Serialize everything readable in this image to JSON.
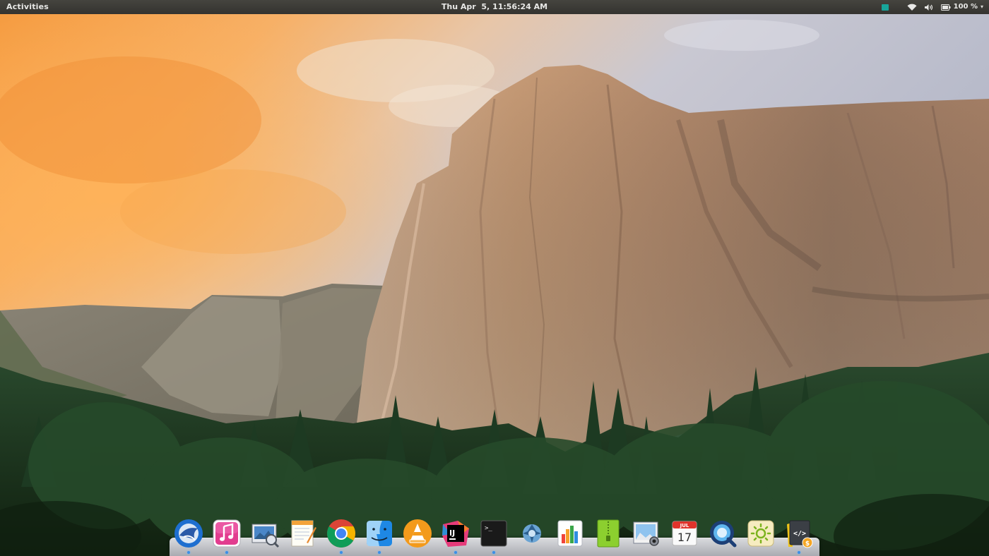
{
  "topbar": {
    "activities_label": "Activities",
    "clock": "Thu Apr  5, 11:56:24 AM",
    "battery_label": "100 %",
    "tray_icons": [
      "app-indicator-icon",
      "wifi-icon",
      "volume-icon",
      "battery-icon",
      "system-menu-caret-icon"
    ]
  },
  "calendar_icon": {
    "month": "JUL",
    "day": "17"
  },
  "dock": {
    "items": [
      {
        "name": "thunderbird-mail",
        "running": true
      },
      {
        "name": "itunes-music",
        "running": true
      },
      {
        "name": "image-viewer",
        "running": false
      },
      {
        "name": "text-editor",
        "running": false
      },
      {
        "name": "google-chrome",
        "running": true
      },
      {
        "name": "finder-files",
        "running": true
      },
      {
        "name": "vlc-media-player",
        "running": false
      },
      {
        "name": "intellij-idea",
        "running": true
      },
      {
        "name": "terminal",
        "running": true
      },
      {
        "name": "shutter-screenshot",
        "running": false
      },
      {
        "name": "numbers-chart",
        "running": false
      },
      {
        "name": "archive-manager",
        "running": false
      },
      {
        "name": "photo-preview",
        "running": false
      },
      {
        "name": "calendar",
        "running": false
      },
      {
        "name": "quicktime-player",
        "running": false
      },
      {
        "name": "brightness-settings",
        "running": false
      },
      {
        "name": "code-editor",
        "running": true
      }
    ]
  },
  "colors": {
    "topbar": "#3c3b37",
    "running_indicator": "#3a8ee6",
    "sky_orange": "#f6a24b",
    "rock": "#c49874",
    "forest": "#1f3a24"
  }
}
